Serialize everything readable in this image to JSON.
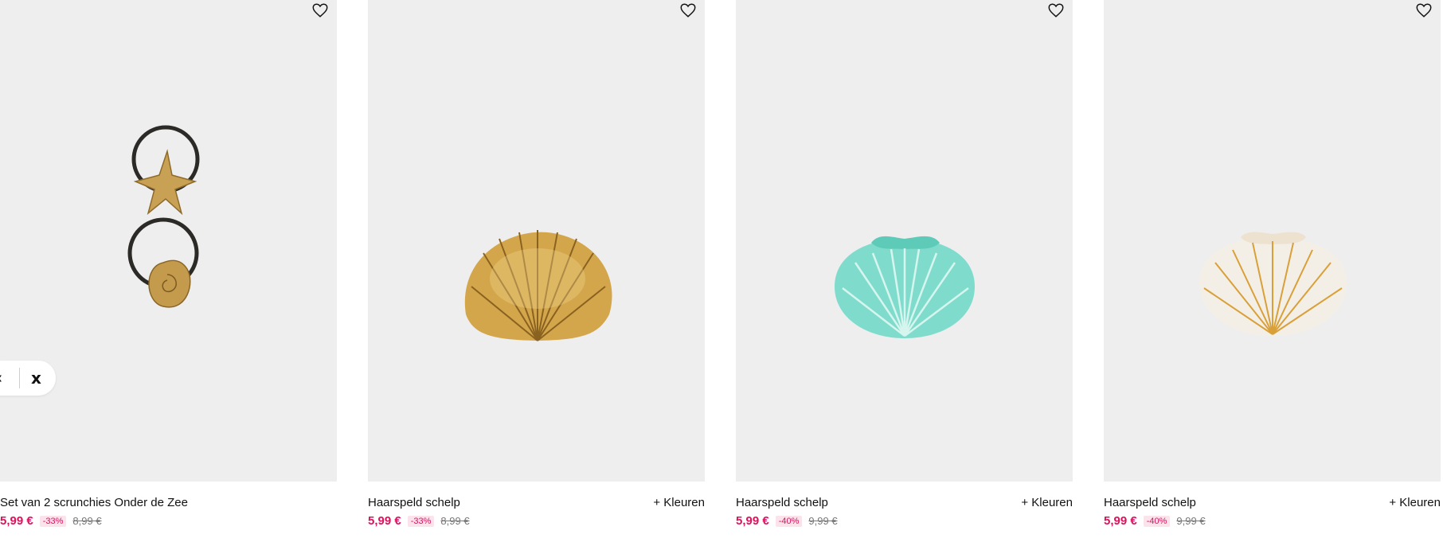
{
  "products": [
    {
      "title": "Set van 2 scrunchies Onder de Zee",
      "price": "5,99 €",
      "discount": "-33%",
      "old_price": "8,99 €",
      "colors_label": "",
      "favorite_icon": "heart-icon"
    },
    {
      "title": "Haarspeld schelp",
      "price": "5,99 €",
      "discount": "-33%",
      "old_price": "8,99 €",
      "colors_label": "+ Kleuren",
      "favorite_icon": "heart-icon"
    },
    {
      "title": "Haarspeld schelp",
      "price": "5,99 €",
      "discount": "-40%",
      "old_price": "9,99 €",
      "colors_label": "+ Kleuren",
      "favorite_icon": "heart-icon"
    },
    {
      "title": "Haarspeld schelp",
      "price": "5,99 €",
      "discount": "-40%",
      "old_price": "9,99 €",
      "colors_label": "+ Kleuren",
      "favorite_icon": "heart-icon"
    }
  ],
  "overlay": {
    "prev_glyph": "‹",
    "close_glyph": "x"
  },
  "colors": {
    "sale": "#d6145c",
    "sale_badge_bg": "#fbe3ec",
    "card_bg": "#efeeef",
    "text": "#111111"
  }
}
